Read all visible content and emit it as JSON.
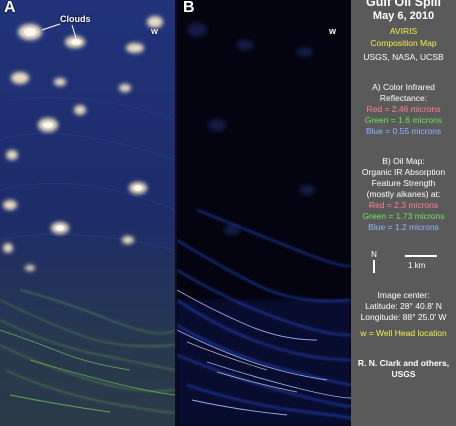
{
  "panel_a": {
    "letter": "A",
    "clouds_label": "Clouds",
    "wellhead_label": "w"
  },
  "panel_b": {
    "letter": "B",
    "wellhead_label": "w"
  },
  "sidebar": {
    "title": "Gulf Oil Spill",
    "date": "May 6, 2010",
    "instrument": "AVIRIS",
    "map_name": "Composition Map",
    "agencies": "USGS, NASA, UCSB",
    "section_a": {
      "heading": "A) Color Infrared",
      "heading2": "Reflectance:",
      "red": "Red  = 2.46 microns",
      "green": "Green = 1.6  microns",
      "blue": "Blue  = 0.55 microns"
    },
    "section_b": {
      "heading": "B) Oil Map:",
      "line1": "Organic IR Absorption",
      "line2": "Feature Strength",
      "line3": "(mostly alkanes) at:",
      "red": "Red = 2.3 microns",
      "green": "Green = 1.73 microns",
      "blue": "Blue = 1.2 microns"
    },
    "north_label": "N",
    "scale_label": "1 km",
    "image_center": {
      "heading": "Image center:",
      "latitude": "Latitude: 28° 40.8' N",
      "longitude": "Longitude: 88° 25.0' W"
    },
    "wellhead_legend": "w = Well Head location",
    "credit": "R. N. Clark and others,",
    "credit2": "USGS"
  },
  "colors": {
    "sidebar_bg": "#5a5a5a",
    "highlight_yellow": "#f6ee4a",
    "red_text": "#ff7f90",
    "green_text": "#6ce35b",
    "blue_text": "#8fb6ff"
  }
}
